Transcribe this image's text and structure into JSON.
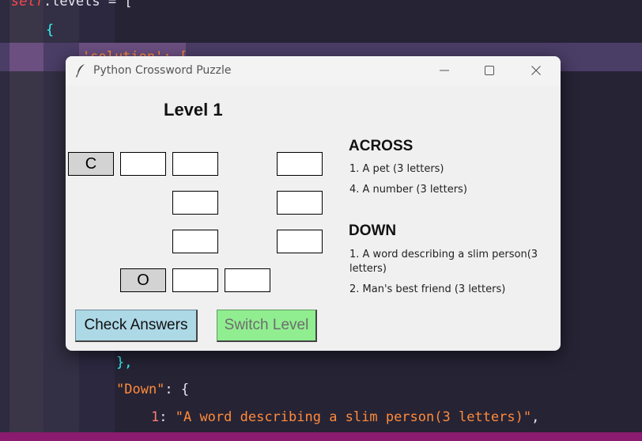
{
  "editor": {
    "lines": {
      "self_kw": "self",
      "levels_assign": ".levels = [",
      "open_brace": "{",
      "solution_key": "'solution': [",
      "close_brace": "},",
      "down_key": "\"Down\"",
      "down_colon": ": {",
      "clue_num": "1",
      "clue_colon": ": ",
      "clue_string": "\"A word describing a slim person(3 letters)\"",
      "clue_comma": ","
    },
    "colors": {
      "background": "#262335",
      "keyword": "#fe4450",
      "text": "#e8e6f0",
      "string": "#ff8b39",
      "punct": "#36f9f6",
      "highlight": "#4a3d66"
    }
  },
  "window": {
    "title": "Python Crossword Puzzle",
    "icon": "feather-icon",
    "controls": [
      "minimize-icon",
      "maximize-icon",
      "close-icon"
    ]
  },
  "puzzle": {
    "level_title": "Level 1",
    "grid": [
      {
        "row": 0,
        "col": 0,
        "letter": "C",
        "given": true
      },
      {
        "row": 0,
        "col": 1,
        "letter": "",
        "given": false
      },
      {
        "row": 0,
        "col": 2,
        "letter": "",
        "given": false
      },
      {
        "row": 0,
        "col": 4,
        "letter": "",
        "given": false
      },
      {
        "row": 1,
        "col": 2,
        "letter": "",
        "given": false
      },
      {
        "row": 1,
        "col": 4,
        "letter": "",
        "given": false
      },
      {
        "row": 2,
        "col": 2,
        "letter": "",
        "given": false
      },
      {
        "row": 2,
        "col": 4,
        "letter": "",
        "given": false
      },
      {
        "row": 3,
        "col": 1,
        "letter": "O",
        "given": true
      },
      {
        "row": 3,
        "col": 2,
        "letter": "",
        "given": false
      },
      {
        "row": 3,
        "col": 3,
        "letter": "",
        "given": false
      }
    ],
    "across": {
      "heading": "ACROSS",
      "clues": [
        "1. A pet (3 letters)",
        "4. A number (3 letters)"
      ]
    },
    "down": {
      "heading": "DOWN",
      "clues": [
        "1. A word describing a slim person(3 letters)",
        "2. Man's best friend (3 letters)"
      ]
    }
  },
  "buttons": {
    "check_label": "Check Answers",
    "switch_label": "Switch Level"
  },
  "colors": {
    "check_button": "#add8e6",
    "switch_button": "#90ee90",
    "given_cell": "#d3d3d3"
  }
}
